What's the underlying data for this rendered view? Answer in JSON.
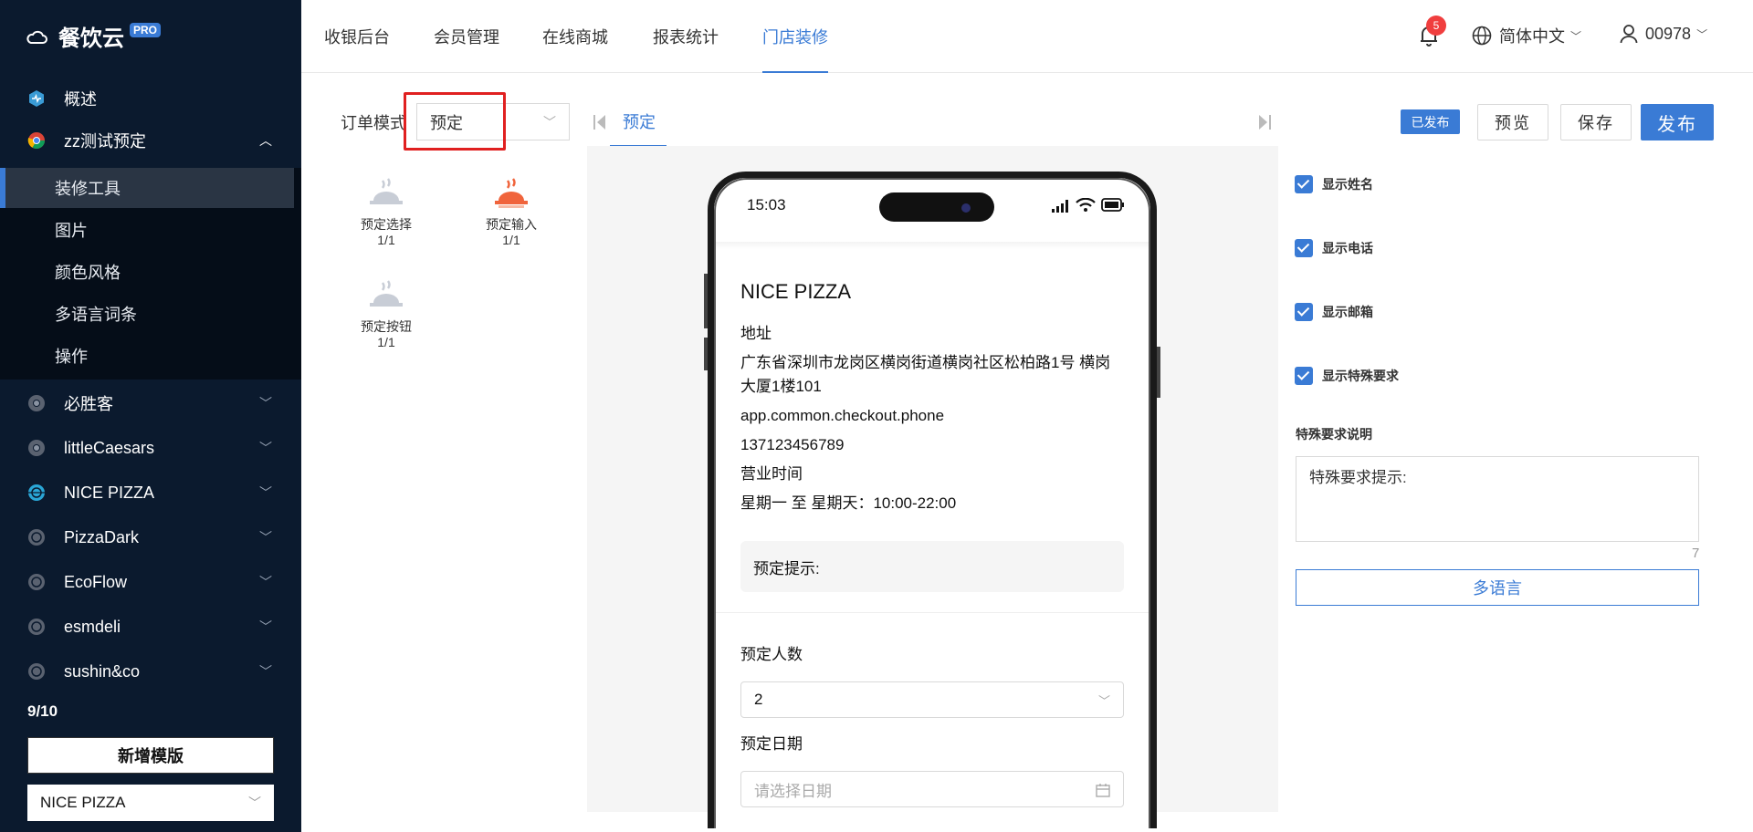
{
  "brand": {
    "name": "餐饮云",
    "badge": "PRO"
  },
  "sidebar": {
    "overview": "概述",
    "current_store": "zz测试预定",
    "sub_items": [
      {
        "label": "装修工具",
        "active": true
      },
      {
        "label": "图片"
      },
      {
        "label": "颜色风格"
      },
      {
        "label": "多语言词条"
      },
      {
        "label": "操作"
      }
    ],
    "stores": [
      "必胜客",
      "littleCaesars",
      "NICE PIZZA",
      "PizzaDark",
      "EcoFlow",
      "esmdeli",
      "sushin&co"
    ],
    "count": "9/10",
    "new_template": "新增模版",
    "template_select": "NICE PIZZA"
  },
  "topnav": {
    "tabs": [
      "收银后台",
      "会员管理",
      "在线商城",
      "报表统计",
      "门店装修"
    ],
    "active_tab": "门店装修",
    "notifications": "5",
    "language": "简体中文",
    "user": "00978"
  },
  "tools": {
    "order_mode_label": "订单模式",
    "order_mode_value": "预定",
    "items": [
      {
        "label": "预定选择",
        "count": "1/1",
        "color": "#c8cdd6"
      },
      {
        "label": "预定输入",
        "count": "1/1",
        "color": "#f0643c"
      },
      {
        "label": "预定按钮",
        "count": "1/1",
        "color": "#c8cdd6"
      }
    ]
  },
  "editor": {
    "tab": "预定"
  },
  "phone": {
    "time": "15:03",
    "store_name": "NICE PIZZA",
    "address_label": "地址",
    "address": "广东省深圳市龙岗区横岗街道横岗社区松柏路1号 横岗大厦1楼101",
    "phone_key": "app.common.checkout.phone",
    "phone": "137123456789",
    "hours_label": "营业时间",
    "hours": "星期一 至 星期天：10:00-22:00",
    "tip": "预定提示:",
    "party_label": "预定人数",
    "party_value": "2",
    "date_label": "预定日期",
    "date_placeholder": "请选择日期"
  },
  "right": {
    "published": "已发布",
    "preview": "预览",
    "save": "保存",
    "publish": "发布",
    "checks": [
      "显示姓名",
      "显示电话",
      "显示邮箱",
      "显示特殊要求"
    ],
    "note_label": "特殊要求说明",
    "note_value": "特殊要求提示:",
    "note_count": "7",
    "multilang": "多语言"
  },
  "colors": {
    "accent": "#3a7bd5",
    "sidebar": "#0b1a2e",
    "badge": "#f03e3e",
    "highlight": "#e02020"
  }
}
